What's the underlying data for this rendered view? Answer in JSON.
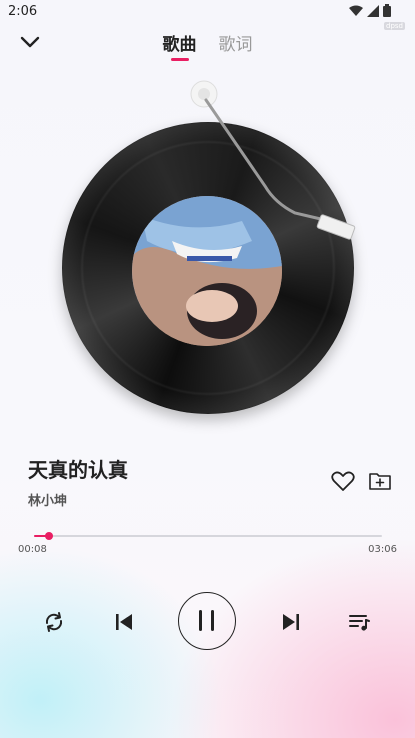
{
  "status": {
    "time": "2:06",
    "badge": "dpsd"
  },
  "header": {
    "tabs": [
      {
        "label": "歌曲",
        "active": true
      },
      {
        "label": "歌词",
        "active": false
      }
    ]
  },
  "song": {
    "title": "天真的认真",
    "artist": "林小坤"
  },
  "progress": {
    "current": "00:08",
    "total": "03:06",
    "fraction": 0.043
  },
  "colors": {
    "accent": "#e91e63",
    "text": "#222222"
  },
  "icons": {
    "back": "chevron-down-icon",
    "favorite": "heart-icon",
    "add": "folder-plus-icon",
    "repeat": "repeat-icon",
    "prev": "skip-previous-icon",
    "play": "pause-icon",
    "next": "skip-next-icon",
    "queue": "playlist-icon"
  }
}
